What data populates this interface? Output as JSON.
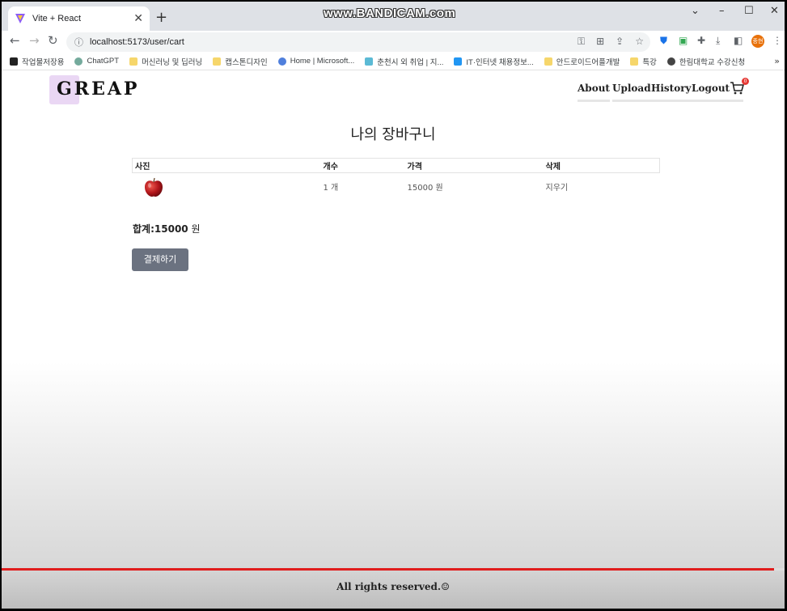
{
  "browser": {
    "tab_title": "Vite + React",
    "tab_close": "✕",
    "new_tab": "+",
    "recorder_watermark": "www.BANDICAM.com",
    "url": "localhost:5173/user/cart",
    "profile_initials": "종현"
  },
  "bookmarks": [
    {
      "label": "작업물저장용",
      "icon": "notion-icon"
    },
    {
      "label": "ChatGPT",
      "icon": "chatgpt-icon"
    },
    {
      "label": "머신러닝 및 딥러닝",
      "icon": "folder-icon"
    },
    {
      "label": "캡스톤디자인",
      "icon": "folder-icon"
    },
    {
      "label": "Home | Microsoft...",
      "icon": "microsoft-icon"
    },
    {
      "label": "춘천시 외 취업 | 지...",
      "icon": "jobs-icon"
    },
    {
      "label": "IT·인터넷 채용정보...",
      "icon": "chat-icon"
    },
    {
      "label": "안드로이드어플개발",
      "icon": "folder-icon"
    },
    {
      "label": "특강",
      "icon": "folder-icon"
    },
    {
      "label": "한림대학교 수강신청",
      "icon": "globe-icon"
    }
  ],
  "bookmarks_more": "»",
  "site": {
    "logo": "GREAP",
    "nav": [
      "About",
      "Upload",
      "History",
      "Logout"
    ],
    "cart_count": "0"
  },
  "cart": {
    "heading": "나의 장바구니",
    "columns": [
      "사진",
      "개수",
      "가격",
      "삭제"
    ],
    "rows": [
      {
        "image": "apple",
        "quantity": "1 개",
        "price": "15000 원",
        "delete": "지우기"
      }
    ],
    "total_label": "합계:",
    "total_value": "15000",
    "total_unit": " 원",
    "checkout_label": "결제하기"
  },
  "footer": {
    "text": "All rights reserved.☺"
  },
  "colors": {
    "logo_highlight": "#ead7f4",
    "checkout_button": "#6b7280",
    "progress_bar": "#e01d1d"
  }
}
